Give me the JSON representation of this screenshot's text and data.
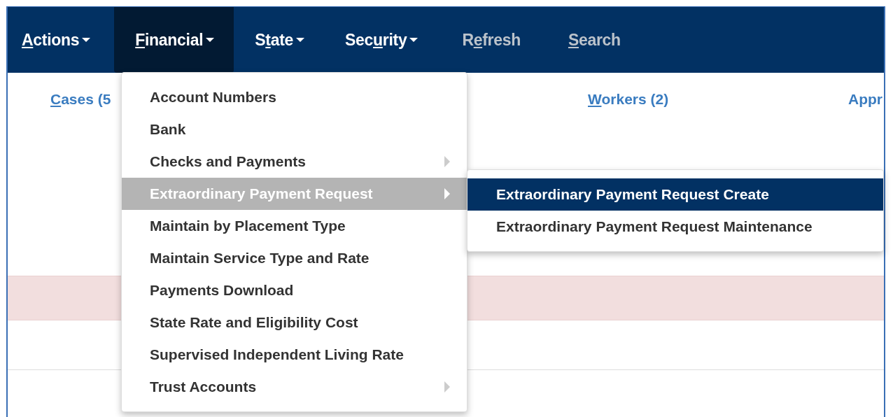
{
  "nav": {
    "items": [
      {
        "key": "A",
        "after": "ctions",
        "dropdown": true,
        "selected": false,
        "disabled": false
      },
      {
        "key": "F",
        "after": "inancial",
        "dropdown": true,
        "selected": true,
        "disabled": false
      },
      {
        "before": "S",
        "key": "t",
        "after": "ate",
        "dropdown": true,
        "selected": false,
        "disabled": false
      },
      {
        "before": "Sec",
        "key": "u",
        "after": "rity",
        "dropdown": true,
        "selected": false,
        "disabled": false
      },
      {
        "before": "R",
        "key": "e",
        "after": "fresh",
        "dropdown": false,
        "selected": false,
        "disabled": true
      },
      {
        "key": "S",
        "after": "earch",
        "dropdown": false,
        "selected": false,
        "disabled": true
      }
    ]
  },
  "summary_links": [
    {
      "key": "C",
      "after": "ases (5"
    },
    {
      "key": "W",
      "after": "orkers (2)"
    },
    {
      "after": "Appr"
    }
  ],
  "financial_menu": {
    "items": [
      {
        "label": "Account Numbers",
        "submenu": false,
        "selected": false
      },
      {
        "label": "Bank",
        "submenu": false,
        "selected": false
      },
      {
        "label": "Checks and Payments",
        "submenu": true,
        "selected": false
      },
      {
        "label": "Extraordinary Payment Request",
        "submenu": true,
        "selected": true
      },
      {
        "label": "Maintain by Placement Type",
        "submenu": false,
        "selected": false
      },
      {
        "label": "Maintain Service Type and Rate",
        "submenu": false,
        "selected": false
      },
      {
        "label": "Payments Download",
        "submenu": false,
        "selected": false
      },
      {
        "label": "State Rate and Eligibility Cost",
        "submenu": false,
        "selected": false
      },
      {
        "label": "Supervised Independent Living Rate",
        "submenu": false,
        "selected": false
      },
      {
        "label": "Trust Accounts",
        "submenu": true,
        "selected": false
      }
    ]
  },
  "submenu": {
    "items": [
      {
        "label": "Extraordinary Payment Request Create",
        "submenu": false,
        "selected": true
      },
      {
        "label": "Extraordinary Payment Request Maintenance",
        "submenu": false,
        "selected": false
      }
    ]
  }
}
